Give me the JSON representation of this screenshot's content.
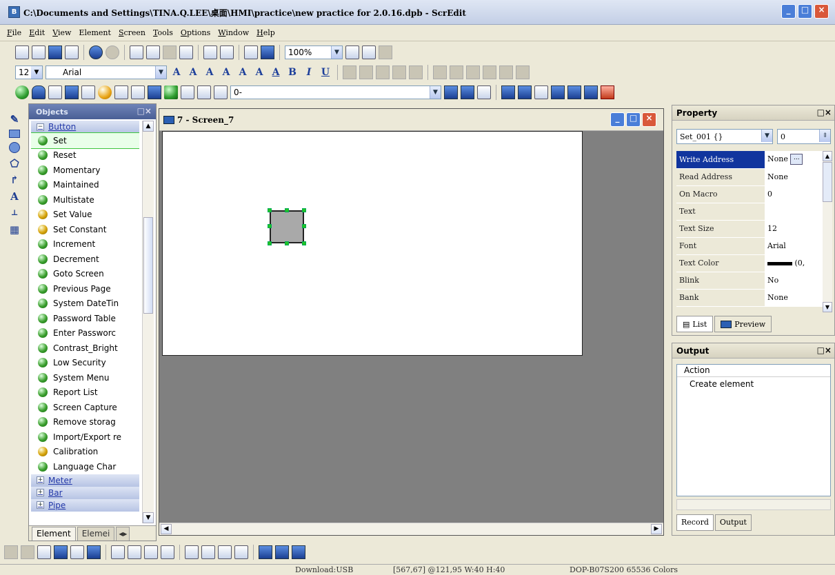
{
  "window": {
    "title": "C:\\Documents and Settings\\TINA.Q.LEE\\桌面\\HMI\\practice\\new practice for 2.0.16.dpb - ScrEdit"
  },
  "menu": [
    {
      "label": "File",
      "u": "F",
      "rest": "ile"
    },
    {
      "label": "Edit",
      "u": "E",
      "rest": "dit"
    },
    {
      "label": "View",
      "u": "V",
      "rest": "iew"
    },
    {
      "label": "Element",
      "u": "",
      "rest": "Element"
    },
    {
      "label": "Screen",
      "u": "S",
      "rest": "creen"
    },
    {
      "label": "Tools",
      "u": "T",
      "rest": "ools"
    },
    {
      "label": "Options",
      "u": "O",
      "rest": "ptions"
    },
    {
      "label": "Window",
      "u": "W",
      "rest": "indow"
    },
    {
      "label": "Help",
      "u": "H",
      "rest": "elp"
    }
  ],
  "toolbar": {
    "zoom": "100%",
    "font_size": "12",
    "font_name": "Arial",
    "element_combo": "0-"
  },
  "objects": {
    "title": "Objects",
    "group_button": "Button",
    "items": [
      "Set",
      "Reset",
      "Momentary",
      "Maintained",
      "Multistate",
      "Set Value",
      "Set Constant",
      "Increment",
      "Decrement",
      "Goto Screen",
      "Previous Page",
      "System DateTin",
      "Password Table",
      "Enter Passworc",
      "Contrast_Bright",
      "Low Security",
      "System Menu",
      "Report List",
      "Screen Capture",
      "Remove storag",
      "Import/Export re",
      "Calibration",
      "Language Char"
    ],
    "groups_after": [
      "Meter",
      "Bar",
      "Pipe"
    ],
    "tabs": [
      "Element",
      "Elemei"
    ]
  },
  "screen": {
    "title": "7 - Screen_7"
  },
  "property": {
    "title": "Property",
    "selected": "Set_001 {}",
    "number": "0",
    "rows": [
      {
        "name": "Write Address",
        "value": "None"
      },
      {
        "name": "Read Address",
        "value": "None"
      },
      {
        "name": "On Macro",
        "value": "0"
      },
      {
        "name": "Text",
        "value": ""
      },
      {
        "name": "Text Size",
        "value": "12"
      },
      {
        "name": "Font",
        "value": "Arial"
      },
      {
        "name": "Text Color",
        "value": "(0,"
      },
      {
        "name": "Blink",
        "value": "No"
      },
      {
        "name": "Bank",
        "value": "None"
      }
    ],
    "tabs": [
      "List",
      "Preview"
    ]
  },
  "output": {
    "title": "Output",
    "column": "Action",
    "rows": [
      "Create element"
    ],
    "tabs": [
      "Record",
      "Output"
    ]
  },
  "status": {
    "download": "Download:USB",
    "position": "[567,67] @121,95 W:40 H:40",
    "model": "DOP-B07S200 65536 Colors"
  },
  "colors": {
    "selection": "#11359e",
    "handle": "#22c522",
    "panel": "#ece9d8"
  }
}
